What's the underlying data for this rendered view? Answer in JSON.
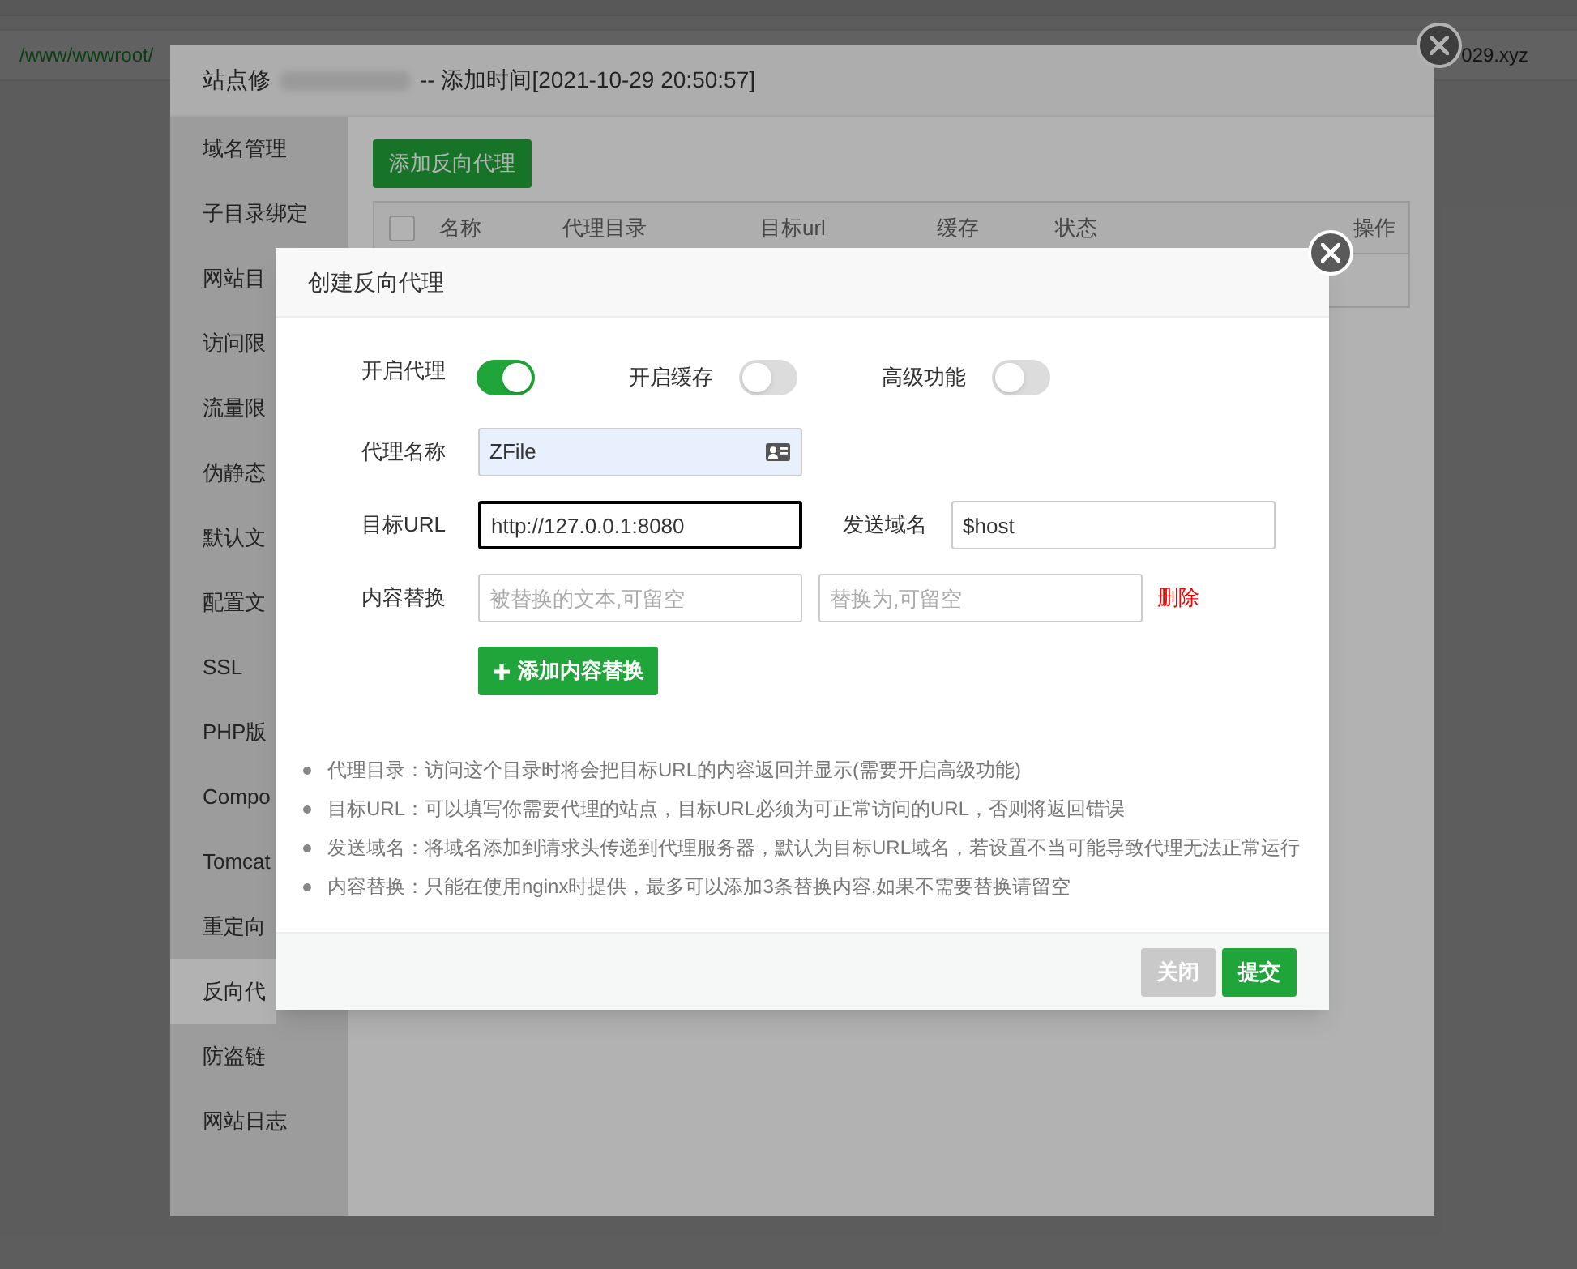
{
  "background_page": {
    "path": "/www/wwwroot/",
    "domain_tail": "029.xyz"
  },
  "site_dialog": {
    "title_prefix": "站点修",
    "title_suffix": "-- 添加时间[2021-10-29 20:50:57]",
    "sidebar": [
      {
        "label": "域名管理",
        "selected": false
      },
      {
        "label": "子目录绑定",
        "selected": false
      },
      {
        "label": "网站目",
        "selected": false
      },
      {
        "label": "访问限",
        "selected": false
      },
      {
        "label": "流量限",
        "selected": false
      },
      {
        "label": "伪静态",
        "selected": false
      },
      {
        "label": "默认文",
        "selected": false
      },
      {
        "label": "配置文",
        "selected": false
      },
      {
        "label": "SSL",
        "selected": false
      },
      {
        "label": "PHP版",
        "selected": false
      },
      {
        "label": "Compo",
        "selected": false
      },
      {
        "label": "Tomcat",
        "selected": false
      },
      {
        "label": "重定向",
        "selected": false
      },
      {
        "label": "反向代",
        "selected": true
      },
      {
        "label": "防盗链",
        "selected": false
      },
      {
        "label": "网站日志",
        "selected": false
      }
    ],
    "add_button": "添加反向代理",
    "table": {
      "select_all_checked": false,
      "columns": [
        "名称",
        "代理目录",
        "目标url",
        "缓存",
        "状态",
        "操作"
      ]
    }
  },
  "proxy_dialog": {
    "title": "创建反向代理",
    "toggles": [
      {
        "label": "开启代理",
        "on": true
      },
      {
        "label": "开启缓存",
        "on": false
      },
      {
        "label": "高级功能",
        "on": false
      }
    ],
    "name_field": {
      "label": "代理名称",
      "value": "ZFile",
      "autofilled": true
    },
    "target_url_field": {
      "label": "目标URL",
      "value": "http://127.0.0.1:8080",
      "focused": true
    },
    "send_domain_field": {
      "label": "发送域名",
      "value": "$host",
      "focused": false
    },
    "content_replace": {
      "label": "内容替换",
      "from_placeholder": "被替换的文本,可留空",
      "to_placeholder": "替换为,可留空",
      "delete": "删除"
    },
    "add_replace_button": "添加内容替换",
    "notes": [
      "代理目录：访问这个目录时将会把目标URL的内容返回并显示(需要开启高级功能)",
      "目标URL：可以填写你需要代理的站点，目标URL必须为可正常访问的URL，否则将返回错误",
      "发送域名：将域名添加到请求头传递到代理服务器，默认为目标URL域名，若设置不当可能导致代理无法正常运行",
      "内容替换：只能在使用nginx时提供，最多可以添加3条替换内容,如果不需要替换请留空"
    ],
    "buttons": [
      {
        "label": "关闭",
        "kind": "secondary"
      },
      {
        "label": "提交",
        "kind": "primary"
      }
    ]
  }
}
